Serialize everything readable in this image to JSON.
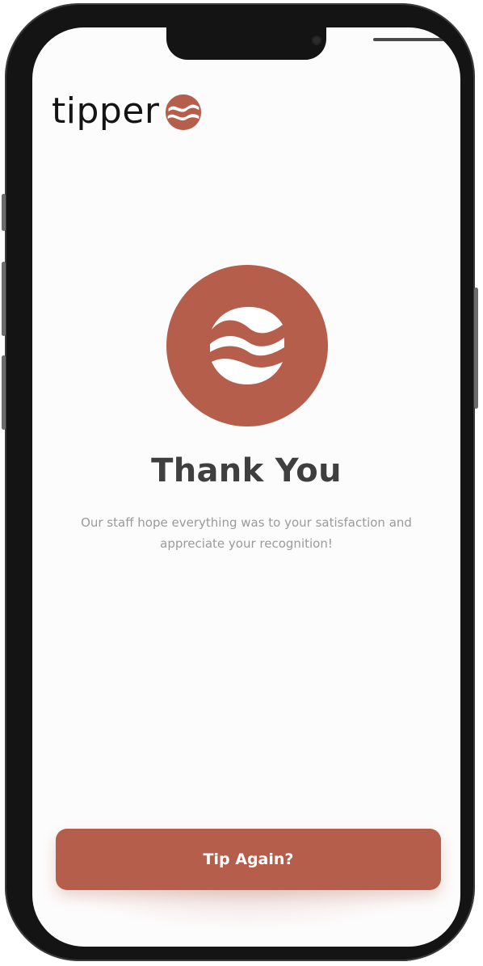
{
  "brand": {
    "name": "tipper",
    "mark_icon": "tipper-wave-logo-icon"
  },
  "hero": {
    "icon": "tipper-wave-logo-icon"
  },
  "content": {
    "title": "Thank You",
    "message_line1": "Our staff hope everything was to your satisfaction and",
    "message_line2": "appreciate your recognition!"
  },
  "actions": {
    "tip_again_label": "Tip Again?"
  },
  "colors": {
    "accent": "#b55e4b",
    "title": "#3f3f3f",
    "muted": "#9a9a9a"
  }
}
